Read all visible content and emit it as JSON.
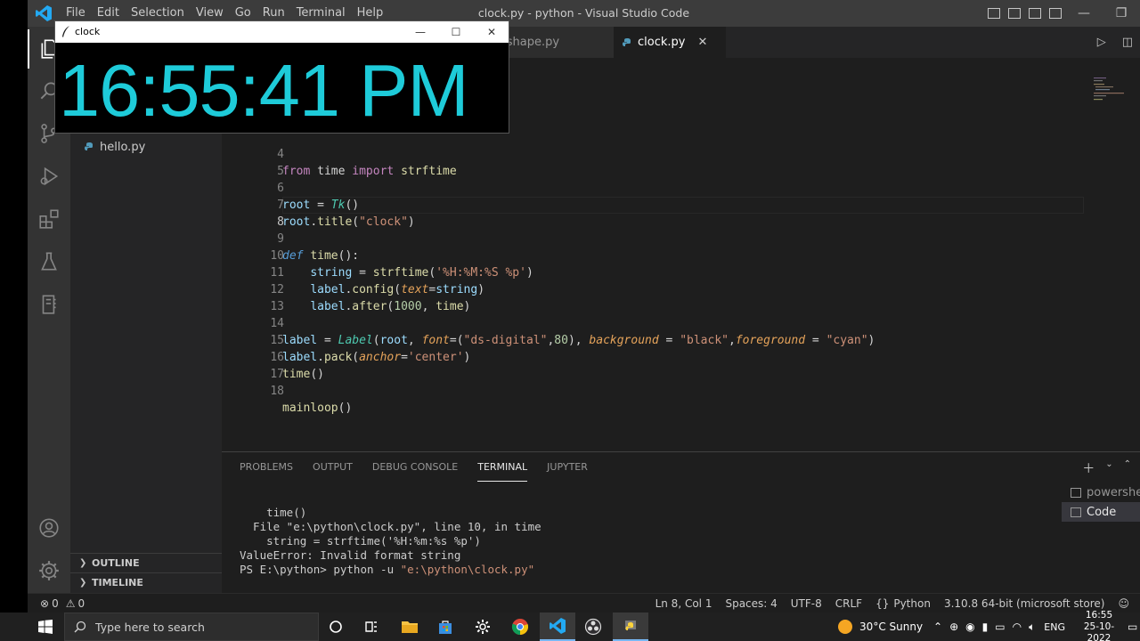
{
  "vscode": {
    "menu": [
      "File",
      "Edit",
      "Selection",
      "View",
      "Go",
      "Run",
      "Terminal",
      "Help"
    ],
    "window_title": "clock.py - python - Visual Studio Code",
    "accent": "#007acc"
  },
  "sidebar": {
    "files": [
      {
        "name": "hello.py"
      }
    ],
    "outline_label": "OUTLINE",
    "timeline_label": "TIMELINE"
  },
  "tabs": [
    {
      "label": "t-shape.py",
      "active": false
    },
    {
      "label": "clock.py",
      "active": true,
      "close": "✕"
    }
  ],
  "editor": {
    "lines": [
      {
        "n": "4"
      },
      {
        "n": "5"
      },
      {
        "n": "6"
      },
      {
        "n": "7"
      },
      {
        "n": "8"
      },
      {
        "n": "9"
      },
      {
        "n": "10"
      },
      {
        "n": "11"
      },
      {
        "n": "12"
      },
      {
        "n": "13"
      },
      {
        "n": "14"
      },
      {
        "n": "15"
      },
      {
        "n": "16"
      },
      {
        "n": "17"
      },
      {
        "n": "18"
      }
    ]
  },
  "panel": {
    "tabs": [
      "PROBLEMS",
      "OUTPUT",
      "DEBUG CONSOLE",
      "TERMINAL",
      "JUPYTER"
    ],
    "active_tab": "TERMINAL",
    "terminal_lines": [
      "    time()",
      "  File \"e:\\python\\clock.py\", line 10, in time",
      "    string = strftime('%H:%m:%s %p')",
      "ValueError: Invalid format string",
      "PS E:\\python> python -u "
    ],
    "terminal_cmd_arg": "\"e:\\python\\clock.py\"",
    "terminals": [
      {
        "label": "powershell",
        "active": false
      },
      {
        "label": "Code",
        "active": true
      }
    ]
  },
  "statusbar": {
    "errors": "0",
    "warnings": "0",
    "position": "Ln 8, Col 1",
    "spaces": "Spaces: 4",
    "encoding": "UTF-8",
    "eol": "CRLF",
    "language": "Python",
    "interpreter": "3.10.8 64-bit (microsoft store)"
  },
  "taskbar": {
    "search_placeholder": "Type here to search",
    "weather": "30°C  Sunny",
    "lang": "ENG",
    "time": "16:55",
    "date": "25-10-2022"
  },
  "clock_window": {
    "title": "clock",
    "time_display": "16:55:41 PM",
    "background": "#000000",
    "foreground": "cyan"
  }
}
